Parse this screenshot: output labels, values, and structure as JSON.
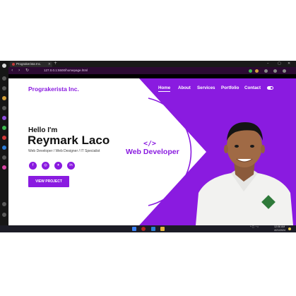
{
  "browser": {
    "tab_title": "Prograkerista Inc.",
    "tab_close": "×",
    "new_tab": "+",
    "url": "127.0.0.1:5500/homepage.html",
    "back": "‹",
    "forward": "›",
    "reload": "↻",
    "minimize": "–",
    "maximize": "▢",
    "close": "✕"
  },
  "site": {
    "logo": "Prograkerista Inc.",
    "nav": [
      "Home",
      "About",
      "Services",
      "Portfolio",
      "Contact"
    ],
    "active_nav": "Home"
  },
  "hero": {
    "greeting": "Hello I'm",
    "name": "Reymark Laco",
    "roles": "Web Developer / Web Designer / IT Specialist",
    "cta": "VIEW PROJECT",
    "social_icons": [
      "facebook-icon",
      "instagram-icon",
      "twitter-icon",
      "linkedin-icon"
    ],
    "code_symbol": "</>",
    "headline": "Web Developer"
  },
  "taskbar": {
    "time": "12:06 AM",
    "date": "4/21/2024"
  },
  "colors": {
    "accent": "#8a1be0",
    "browser_bar": "#2c0a33",
    "taskbar": "#1c1c26"
  }
}
